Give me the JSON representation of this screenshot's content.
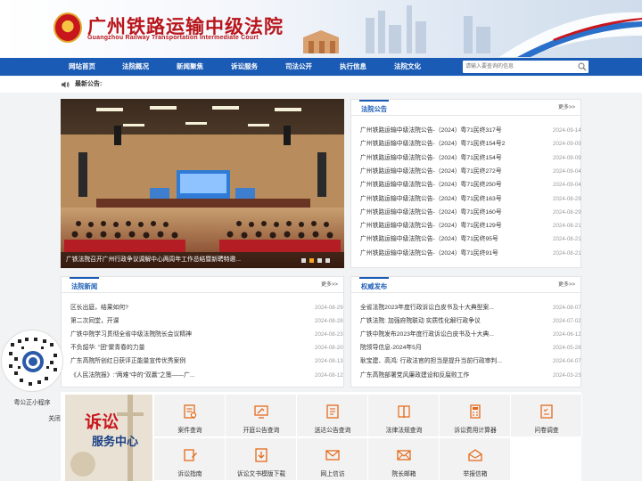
{
  "header": {
    "title": "广州铁路运输中级法院",
    "subtitle": "Guangzhou Railway Transportation Intermediate Court"
  },
  "nav": {
    "items": [
      "网站首页",
      "法院概况",
      "新闻聚焦",
      "诉讼服务",
      "司法公开",
      "执行信息",
      "法院文化"
    ],
    "search_placeholder": "请输入要查询的信息"
  },
  "announcement": {
    "label": "最新公告:"
  },
  "carousel": {
    "caption": "广铁法院召开广州行政争议调解中心两周年工作总结暨新聘特邀...",
    "slide_count": 4,
    "active_slide": 1
  },
  "notices": {
    "title": "法院公告",
    "more": "更多>>",
    "items": [
      {
        "text": "广州铁路运输中级法院公告-（2024）粤71民终317号",
        "date": "2024-09-14"
      },
      {
        "text": "广州铁路运输中级法院公告-（2024）粤71民终154号2",
        "date": "2024-09-09"
      },
      {
        "text": "广州铁路运输中级法院公告-（2024）粤71民终154号",
        "date": "2024-09-09"
      },
      {
        "text": "广州铁路运输中级法院公告-（2024）粤71民终272号",
        "date": "2024-09-04"
      },
      {
        "text": "广州铁路运输中级法院公告-（2024）粤71民终250号",
        "date": "2024-09-04"
      },
      {
        "text": "广州铁路运输中级法院公告-（2024）粤71民终163号",
        "date": "2024-08-29"
      },
      {
        "text": "广州铁路运输中级法院公告-（2024）粤71民终160号",
        "date": "2024-08-29"
      },
      {
        "text": "广州铁路运输中级法院公告-（2024）粤71民终129号",
        "date": "2024-08-21"
      },
      {
        "text": "广州铁路运输中级法院公告-（2024）粤71民终95号",
        "date": "2024-08-21"
      },
      {
        "text": "广州铁路运输中级法院公告-（2024）粤71民终91号",
        "date": "2024-08-21"
      }
    ]
  },
  "news": {
    "title": "法院新闻",
    "more": "更多>>",
    "items": [
      {
        "text": "区长出庭，结果如何?",
        "date": "2024-08-29"
      },
      {
        "text": "第二次同堂，开课",
        "date": "2024-08-28"
      },
      {
        "text": "广铁中院学习贯彻全省中级法院院长会议精神",
        "date": "2024-08-23"
      },
      {
        "text": "不负韶华: \"团\"聚青春的力量",
        "date": "2024-08-20"
      },
      {
        "text": "广东高院所创红日获评正能量宣传优秀案例",
        "date": "2024-08-13"
      },
      {
        "text": "《人民法院报》:\"两难\"中的\"双赢\"之策——广...",
        "date": "2024-08-12"
      }
    ]
  },
  "releases": {
    "title": "权威发布",
    "more": "更多>>",
    "items": [
      {
        "text": "全省法院2023年度行政诉讼白皮书及十大典型案...",
        "date": "2024-08-07"
      },
      {
        "text": "广铁法院: 加强府院联动 实质性化解行政争议",
        "date": "2024-07-02"
      },
      {
        "text": "广铁中院发布2023年度行政诉讼白皮书及十大典...",
        "date": "2024-06-12"
      },
      {
        "text": "院领导信息-2024年5月",
        "date": "2024-05-28"
      },
      {
        "text": "耿宝建、高鸿: 行政法官的担当是提升当前行政审判...",
        "date": "2024-04-07"
      },
      {
        "text": "广东高院部署党风廉政建设和反腐败工作",
        "date": "2024-03-23"
      }
    ]
  },
  "services": {
    "banner_t1": "诉讼",
    "banner_t2": "服务中心",
    "tiles": [
      {
        "label": "案件查询",
        "icon": "search-document-icon"
      },
      {
        "label": "开庭公告查询",
        "icon": "hammer-board-icon"
      },
      {
        "label": "送达公告查询",
        "icon": "delivery-notice-icon"
      },
      {
        "label": "法律法规查询",
        "icon": "law-book-icon"
      },
      {
        "label": "诉讼费用计算器",
        "icon": "calculator-icon"
      },
      {
        "label": "问卷调查",
        "icon": "questionnaire-icon"
      },
      {
        "label": "诉讼指南",
        "icon": "guide-icon"
      },
      {
        "label": "诉讼文书模版下载",
        "icon": "download-document-icon"
      },
      {
        "label": "网上信访",
        "icon": "online-petition-icon"
      },
      {
        "label": "院长邮箱",
        "icon": "mail-icon"
      },
      {
        "label": "举报信箱",
        "icon": "report-mailbox-icon"
      }
    ]
  },
  "mini_program": {
    "label": "粤公正小程序",
    "close": "关闭"
  },
  "colors": {
    "primary": "#1a5bb5",
    "brand_red": "#b8161c",
    "accent_orange": "#e46a1a"
  }
}
